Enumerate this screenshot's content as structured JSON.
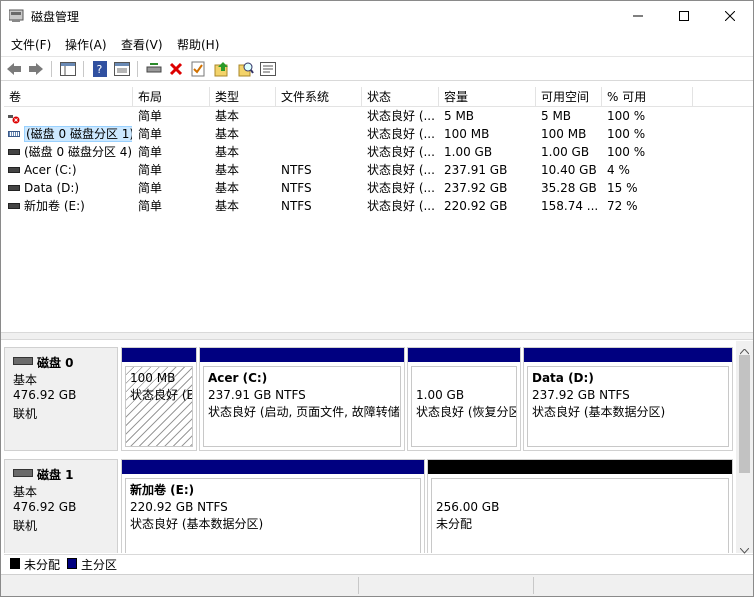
{
  "window": {
    "title": "磁盘管理",
    "minimize_icon": "minimize-icon",
    "maximize_icon": "maximize-icon",
    "close_icon": "close-icon"
  },
  "menu": [
    "文件(F)",
    "操作(A)",
    "查看(V)",
    "帮助(H)"
  ],
  "toolbar": [
    "back-icon",
    "forward-icon",
    "show-hide-console-tree-icon",
    "help-icon",
    "properties-icon",
    "connect-disk-icon",
    "delete-icon",
    "check-icon",
    "export-icon",
    "search-icon",
    "rescan-icon"
  ],
  "volume_list": {
    "columns": [
      "卷",
      "布局",
      "类型",
      "文件系统",
      "状态",
      "容量",
      "可用空间",
      "% 可用"
    ],
    "rows": [
      {
        "icon": "error-volume-icon",
        "name": "",
        "layout": "简单",
        "type": "基本",
        "fs": "",
        "status": "状态良好 (...",
        "capacity": "5 MB",
        "free": "5 MB",
        "pct": "100 %"
      },
      {
        "icon": "volume-icon",
        "name": "(磁盘 0 磁盘分区 1)",
        "layout": "简单",
        "type": "基本",
        "fs": "",
        "status": "状态良好 (...",
        "capacity": "100 MB",
        "free": "100 MB",
        "pct": "100 %",
        "selected": true
      },
      {
        "icon": "volume-icon",
        "name": "(磁盘 0 磁盘分区 4)",
        "layout": "简单",
        "type": "基本",
        "fs": "",
        "status": "状态良好 (...",
        "capacity": "1.00 GB",
        "free": "1.00 GB",
        "pct": "100 %"
      },
      {
        "icon": "volume-icon",
        "name": "Acer (C:)",
        "layout": "简单",
        "type": "基本",
        "fs": "NTFS",
        "status": "状态良好 (...",
        "capacity": "237.91 GB",
        "free": "10.40 GB",
        "pct": "4 %"
      },
      {
        "icon": "volume-icon",
        "name": "Data (D:)",
        "layout": "简单",
        "type": "基本",
        "fs": "NTFS",
        "status": "状态良好 (...",
        "capacity": "237.92 GB",
        "free": "35.28 GB",
        "pct": "15 %"
      },
      {
        "icon": "volume-icon",
        "name": "新加卷 (E:)",
        "layout": "简单",
        "type": "基本",
        "fs": "NTFS",
        "status": "状态良好 (...",
        "capacity": "220.92 GB",
        "free": "158.74 ...",
        "pct": "72 %"
      }
    ]
  },
  "disks": [
    {
      "name": "磁盘 0",
      "type": "基本",
      "size": "476.92 GB",
      "state": "联机",
      "partitions": [
        {
          "title": "",
          "size": "100 MB",
          "status": "状态良好 (EFI 系统分区)",
          "color": "#000080",
          "hatched": true
        },
        {
          "title": "Acer  (C:)",
          "size": "237.91 GB NTFS",
          "status": "状态良好 (启动, 页面文件, 故障转储, 基本数据分区)",
          "color": "#000080"
        },
        {
          "title": "",
          "size": "1.00 GB",
          "status": "状态良好 (恢复分区)",
          "color": "#000080"
        },
        {
          "title": "Data  (D:)",
          "size": "237.92 GB NTFS",
          "status": "状态良好 (基本数据分区)",
          "color": "#000080"
        }
      ]
    },
    {
      "name": "磁盘 1",
      "type": "基本",
      "size": "476.92 GB",
      "state": "联机",
      "partitions": [
        {
          "title": "新加卷  (E:)",
          "size": "220.92 GB NTFS",
          "status": "状态良好 (基本数据分区)",
          "color": "#000080"
        },
        {
          "title": "",
          "size": "256.00 GB",
          "status": "未分配",
          "color": "#000000"
        }
      ]
    }
  ],
  "legend": [
    {
      "label": "未分配",
      "color": "#000000"
    },
    {
      "label": "主分区",
      "color": "#000080"
    }
  ],
  "colors": {
    "primary_partition": "#000080",
    "unallocated": "#000000",
    "selection": "#cce8ff"
  }
}
